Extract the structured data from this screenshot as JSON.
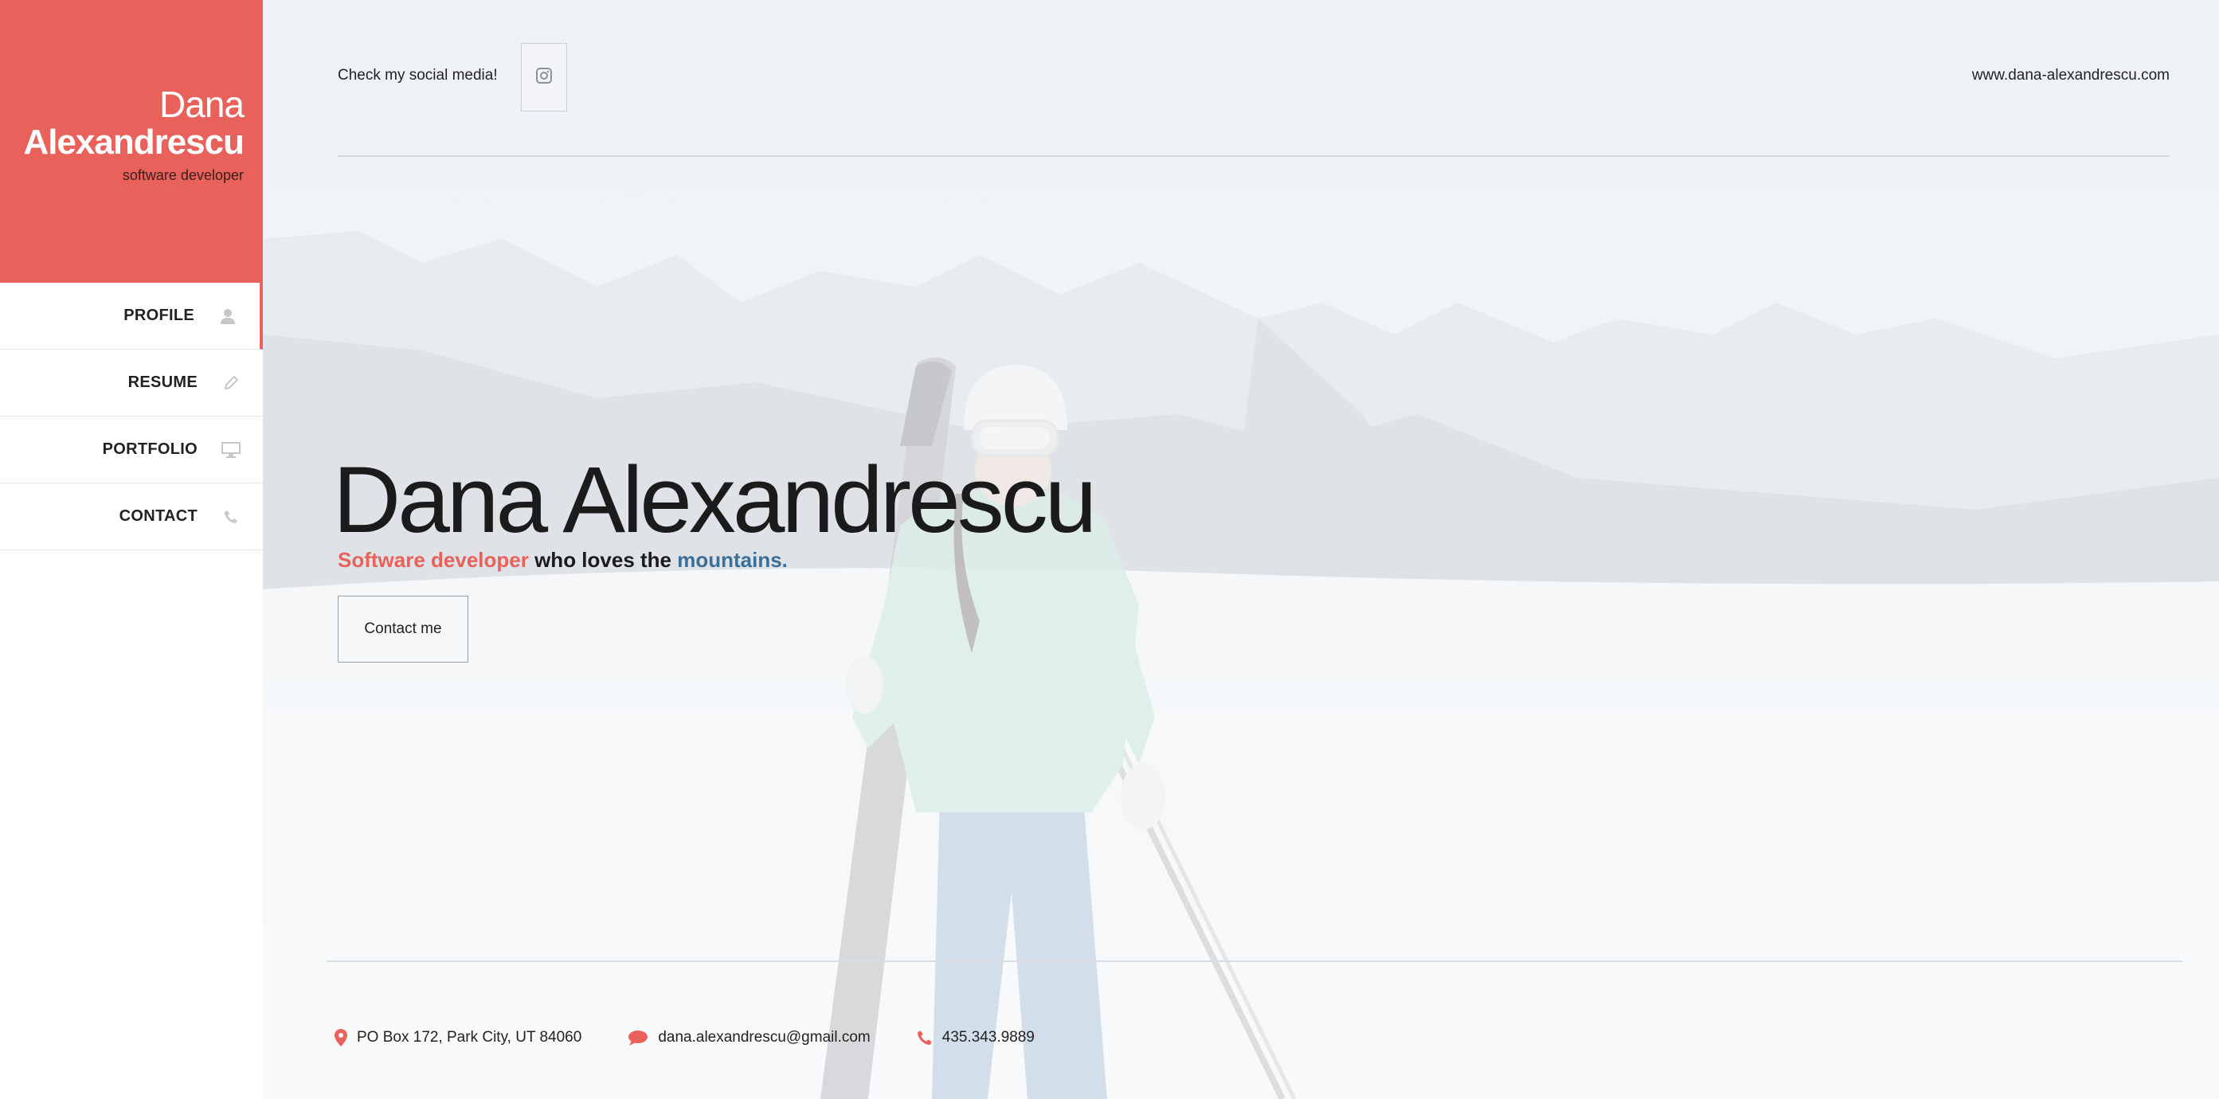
{
  "brand": {
    "first_name": "Dana",
    "last_name": "Alexandrescu",
    "role": "software developer",
    "accent_color": "#e8615a"
  },
  "nav": {
    "items": [
      {
        "label": "PROFILE",
        "icon": "user-icon",
        "active": true
      },
      {
        "label": "RESUME",
        "icon": "pencil-icon",
        "active": false
      },
      {
        "label": "PORTFOLIO",
        "icon": "monitor-icon",
        "active": false
      },
      {
        "label": "CONTACT",
        "icon": "phone-icon",
        "active": false
      }
    ]
  },
  "topbar": {
    "social_text": "Check my social media!",
    "social_icon": "instagram-icon",
    "website": "www.dana-alexandrescu.com"
  },
  "hero": {
    "name": "Dana Alexandrescu",
    "sub_red": "Software developer",
    "sub_mid": " who loves the ",
    "sub_blue": "mountains.",
    "cta": "Contact me"
  },
  "footer": {
    "address": "PO Box 172, Park City, UT 84060",
    "email": "dana.alexandrescu@gmail.com",
    "phone": "435.343.9889"
  }
}
